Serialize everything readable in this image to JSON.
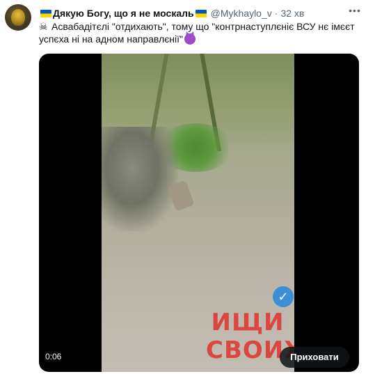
{
  "tweet": {
    "display_name": "Дякую Богу, що я не москаль",
    "handle": "@Mykhaylo_v",
    "separator": "·",
    "time": "32 хв",
    "more_icon": "more-horizontal-icon",
    "text": "Асвабадітєлі \"отдихають\", тому що \"контрнаступлєніє ВСУ нє імєєт успєха ні на адном направлєнії\"",
    "flag_color_top": "#0057b7",
    "flag_color_bottom": "#ffd700"
  },
  "media": {
    "duration": "0:06",
    "hide_button_label": "Приховати",
    "watermark_text": "ИЩИ СВОИХ"
  }
}
